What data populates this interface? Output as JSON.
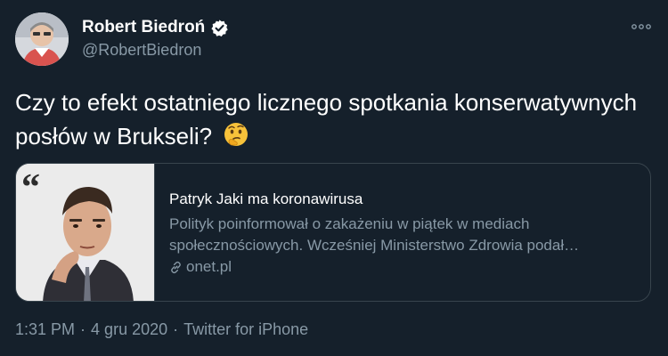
{
  "author": {
    "name": "Robert Biedroń",
    "handle": "@RobertBiedron",
    "verified": true
  },
  "tweet": {
    "text": "Czy to efekt ostatniego licznego spotkania konserwatywnych posłów w Brukseli?",
    "emoji": "thinking-face"
  },
  "card": {
    "title": "Patryk Jaki ma koronawirusa",
    "description_line1": "Polityk poinformował o zakażeniu w piątek w mediach",
    "description_line2": "społecznościowych. Wcześniej Ministerstwo Zdrowia podał…",
    "domain": "onet.pl"
  },
  "meta": {
    "time": "1:31 PM",
    "date": "4 gru 2020",
    "source": "Twitter for iPhone",
    "separator": "·"
  },
  "colors": {
    "background": "#15202b",
    "secondary_text": "#8899a6",
    "border": "#38444d",
    "verified": "#1da1f2"
  }
}
